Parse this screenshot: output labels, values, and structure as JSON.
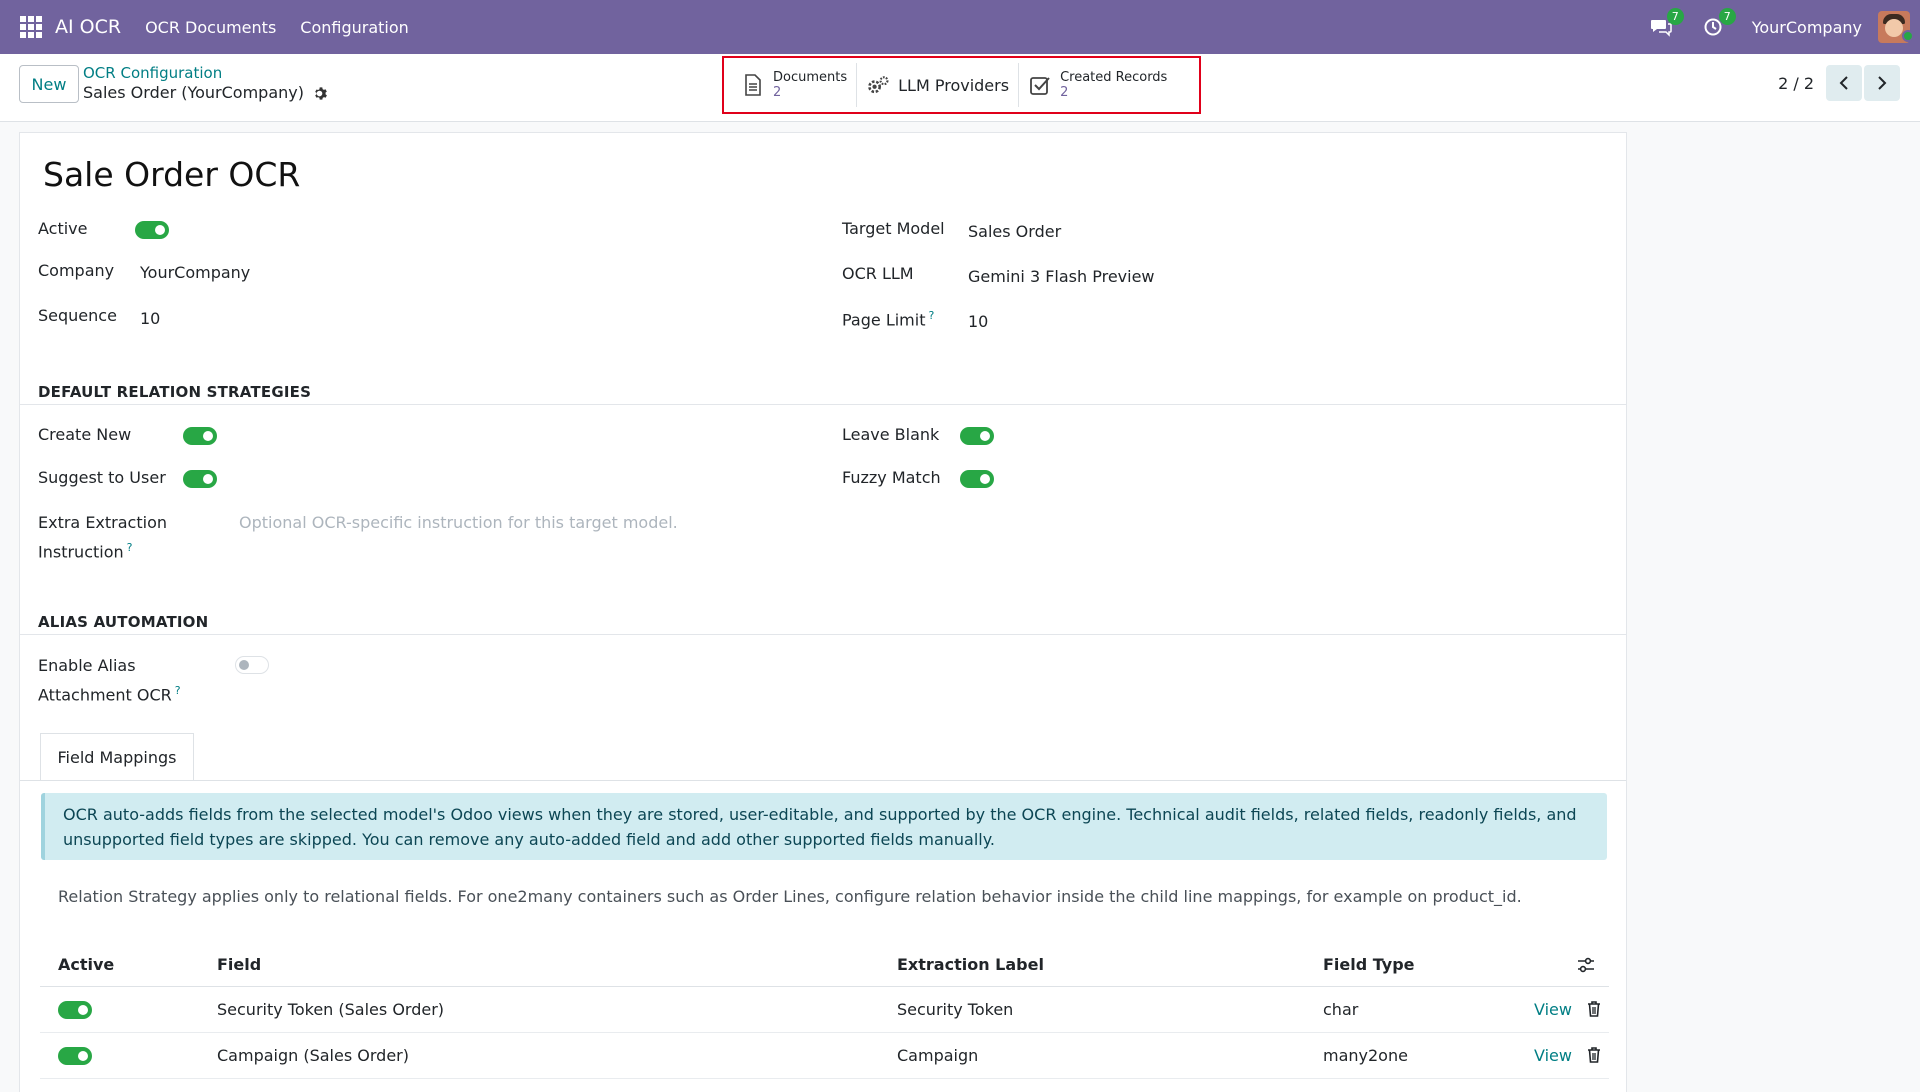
{
  "navbar": {
    "app_name": "AI OCR",
    "menu": [
      "OCR Documents",
      "Configuration"
    ],
    "messages_count": "7",
    "activities_count": "7",
    "company": "YourCompany"
  },
  "control_panel": {
    "new_label": "New",
    "breadcrumb_parent": "OCR Configuration",
    "breadcrumb_current": "Sales Order (YourCompany)",
    "smart_buttons": {
      "documents": {
        "label": "Documents",
        "count": "2"
      },
      "llm_providers": {
        "label": "LLM Providers"
      },
      "created_records": {
        "label": "Created Records",
        "count": "2"
      }
    },
    "pager": "2 / 2"
  },
  "form": {
    "title": "Sale Order OCR",
    "active_label": "Active",
    "company_label": "Company",
    "company_value": "YourCompany",
    "sequence_label": "Sequence",
    "sequence_value": "10",
    "target_model_label": "Target Model",
    "target_model_value": "Sales Order",
    "ocr_llm_label": "OCR LLM",
    "ocr_llm_value": "Gemini 3 Flash Preview",
    "page_limit_label": "Page Limit",
    "page_limit_value": "10",
    "section_relations": "DEFAULT RELATION STRATEGIES",
    "create_new_label": "Create New",
    "suggest_label": "Suggest to User",
    "leave_blank_label": "Leave Blank",
    "fuzzy_label": "Fuzzy Match",
    "extra_label_1": "Extra Extraction",
    "extra_label_2": "Instruction",
    "extra_placeholder": "Optional OCR-specific instruction for this target model.",
    "section_alias": "ALIAS AUTOMATION",
    "alias_label_1": "Enable Alias",
    "alias_label_2": "Attachment OCR",
    "help_mark": "?"
  },
  "tabs": [
    "Field Mappings"
  ],
  "alert_text": "OCR auto-adds fields from the selected model's Odoo views when they are stored, user-editable, and supported by the OCR engine. Technical audit fields, related fields, readonly fields, and unsupported field types are skipped. You can remove any auto-added field and add other supported fields manually.",
  "note_text": "Relation Strategy applies only to relational fields. For one2many containers such as Order Lines, configure relation behavior inside the child line mappings, for example on product_id.",
  "table": {
    "headers": [
      "Active",
      "Field",
      "Extraction Label",
      "Field Type"
    ],
    "rows": [
      {
        "field": "Security Token (Sales Order)",
        "label": "Security Token",
        "type": "char",
        "action": "View"
      },
      {
        "field": "Campaign (Sales Order)",
        "label": "Campaign",
        "type": "many2one",
        "action": "View"
      }
    ]
  },
  "colors": {
    "navbar": "#71639e",
    "accent": "#017e84",
    "toggle_on": "#28a745",
    "highlight": "#e0001a"
  }
}
